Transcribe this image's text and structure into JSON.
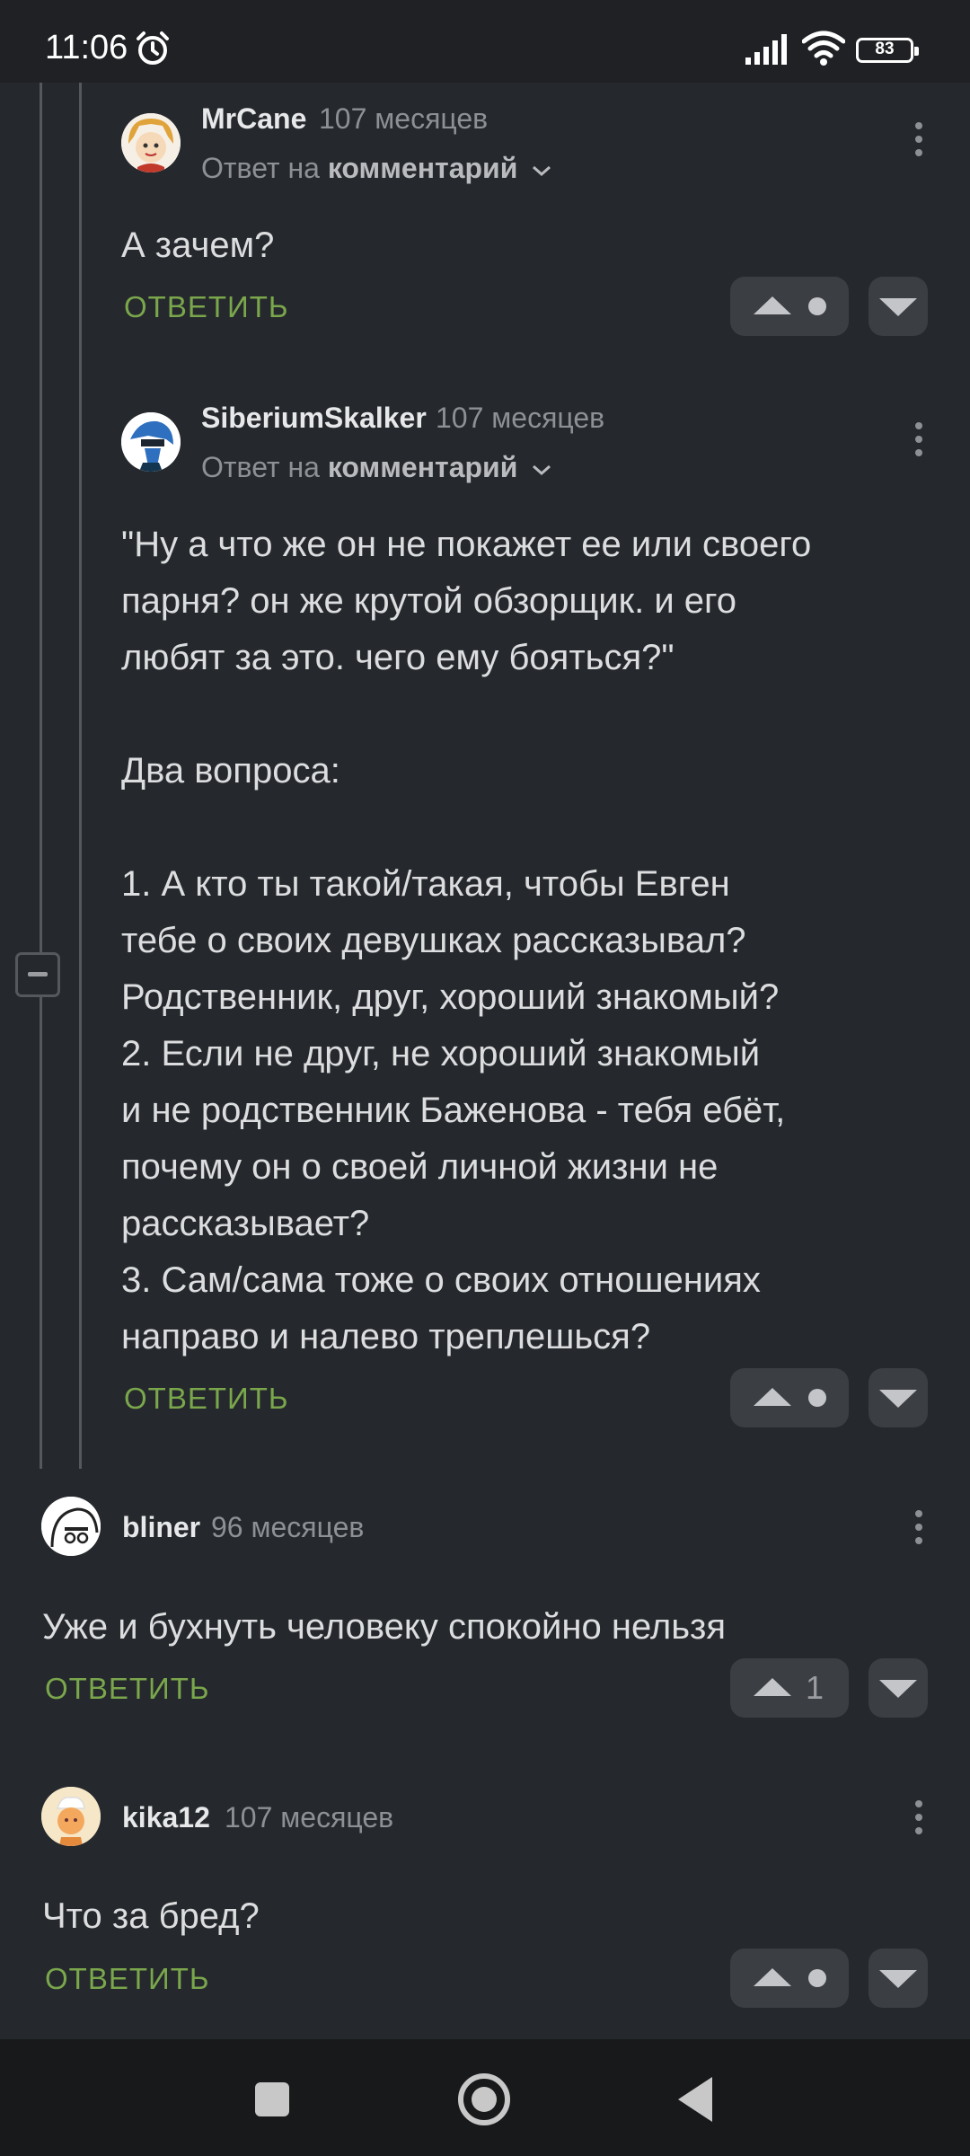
{
  "status_bar": {
    "time": "11:06",
    "battery": "83"
  },
  "comments": [
    {
      "username": "MrCane",
      "time": "107 месяцев",
      "reply_prefix": "Ответ на",
      "reply_target": "комментарий",
      "text": "А зачем?",
      "reply_label": "ОТВЕТИТЬ",
      "rating": ""
    },
    {
      "username": "SiberiumSkalker",
      "time": "107 месяцев",
      "reply_prefix": "Ответ на",
      "reply_target": "комментарий",
      "text": "\"Ну а что же он не покажет ее или своего\nпарня? он же крутой обзорщик. и его\nлюбят за это. чего ему бояться?\"\n\nДва вопроса:\n\n1. А кто ты такой/такая, чтобы Евген\nтебе о своих девушках рассказывал?\nРодственник, друг, хороший знакомый?\n2. Если не друг, не хороший знакомый\nи не родственник Баженова - тебя ебёт,\nпочему он о своей личной жизни не\nрассказывает?\n3. Сам/сама тоже о своих отношениях\nнаправо и налево треплешься?",
      "reply_label": "ОТВЕТИТЬ",
      "rating": ""
    },
    {
      "username": "bliner",
      "time": "96 месяцев",
      "text": "Уже и бухнуть человеку спокойно нельзя",
      "reply_label": "ОТВЕТИТЬ",
      "rating": "1"
    },
    {
      "username": "kika12",
      "time": "107 месяцев",
      "text": "Что за бред?",
      "reply_label": "ОТВЕТИТЬ",
      "rating": ""
    }
  ]
}
